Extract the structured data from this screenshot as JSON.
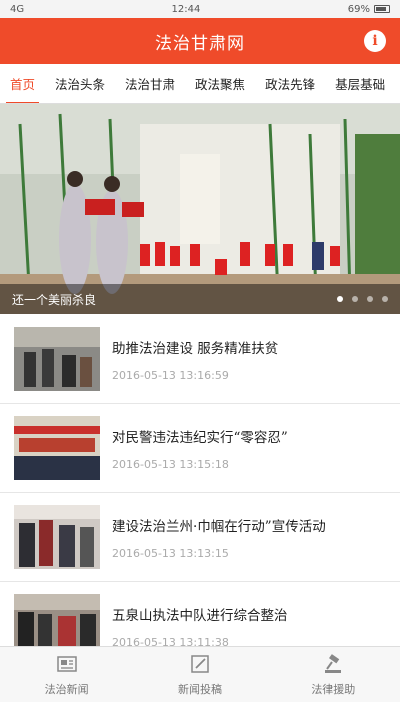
{
  "status": {
    "signal": "4G",
    "time": "12:44",
    "battery": "69%"
  },
  "header": {
    "title": "法治甘肃网",
    "info_icon": "info-icon"
  },
  "tabs": [
    {
      "label": "首页",
      "active": true
    },
    {
      "label": "法治头条"
    },
    {
      "label": "法治甘肃"
    },
    {
      "label": "政法聚焦"
    },
    {
      "label": "政法先锋"
    },
    {
      "label": "基层基础"
    }
  ],
  "banner": {
    "caption": "还一个美丽杀良",
    "slide_count": 4,
    "active_slide": 1
  },
  "news": [
    {
      "title": "助推法治建设 服务精准扶贫",
      "time": "2016-05-13 13:16:59"
    },
    {
      "title": "对民警违法违纪实行“零容忍”",
      "time": "2016-05-13 13:15:18"
    },
    {
      "title": "建设法治兰州·巾帼在行动”宣传活动",
      "time": "2016-05-13 13:13:15"
    },
    {
      "title": "五泉山执法中队进行综合整治",
      "time": "2016-05-13 13:11:38"
    }
  ],
  "bottom_nav": [
    {
      "label": "法治新闻",
      "icon": "newspaper-icon"
    },
    {
      "label": "新闻投稿",
      "icon": "edit-icon"
    },
    {
      "label": "法律援助",
      "icon": "gavel-icon"
    }
  ],
  "colors": {
    "brand": "#ef4b2a"
  }
}
